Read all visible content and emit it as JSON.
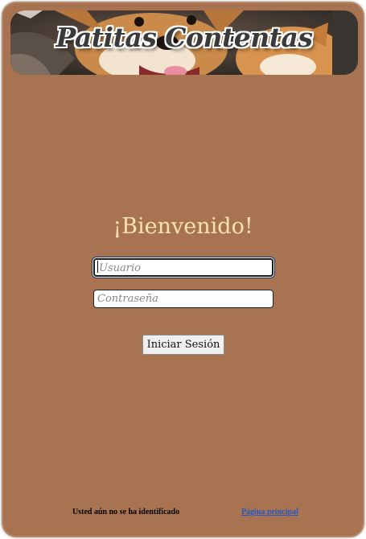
{
  "header": {
    "banner_title": "Patitas Contentas",
    "banner_image": "dogs-photo"
  },
  "login": {
    "welcome": "¡Bienvenido!",
    "username_placeholder": "Usuario",
    "password_placeholder": "Contraseña",
    "submit_label": "Iniciar Sesión"
  },
  "footer": {
    "status_text": "Usted aún no se ha identificado",
    "home_link": "Página principal"
  },
  "colors": {
    "background": "#a87350",
    "welcome_text": "#f9e2b0",
    "link": "#2157c9"
  }
}
